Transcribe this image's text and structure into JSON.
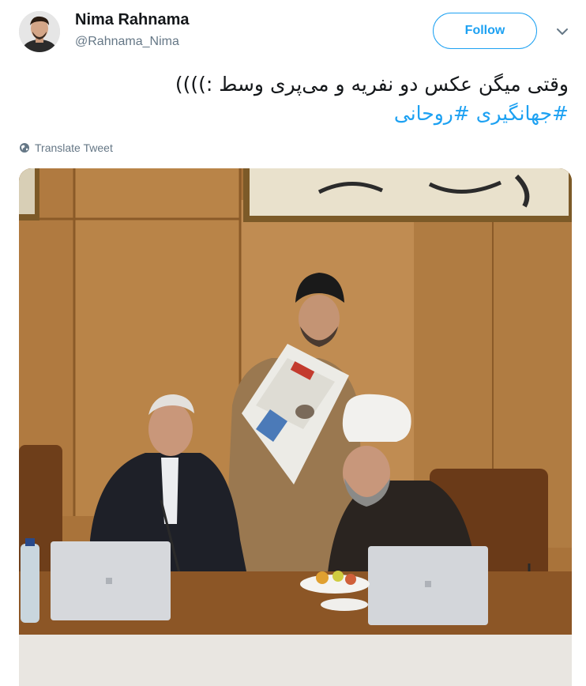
{
  "tweet": {
    "author_name": "Nima Rahnama",
    "author_handle": "@Rahnama_Nima",
    "follow_label": "Follow",
    "text_line_1": "وقتی میگن عکس دو نفریه و می‌پری وسط :))))",
    "hashtag_1": "#جهانگیری",
    "hashtag_2": "#روحانی",
    "translate_label": "Translate Tweet"
  },
  "icons": {
    "more": "chevron-down-icon",
    "translate": "globe-icon"
  },
  "colors": {
    "accent": "#1da1f2",
    "secondary_text": "#657786",
    "primary_text": "#14171a"
  }
}
